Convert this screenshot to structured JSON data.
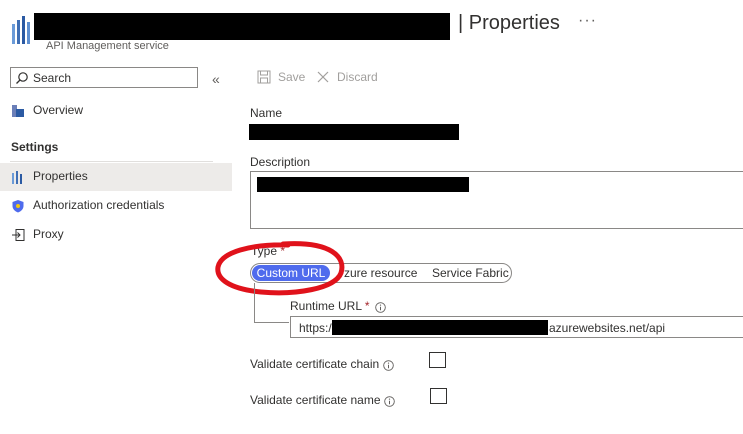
{
  "header": {
    "title": "| Properties",
    "subtitle": "API Management service",
    "more_label": "···"
  },
  "sidebar": {
    "search_placeholder": "Search",
    "collapse_label": "«",
    "items": [
      {
        "label": "Overview"
      },
      {
        "label": "Properties"
      },
      {
        "label": "Authorization credentials"
      },
      {
        "label": "Proxy"
      }
    ],
    "settings_header": "Settings"
  },
  "toolbar": {
    "save_label": "Save",
    "discard_label": "Discard"
  },
  "form": {
    "name_label": "Name",
    "description_label": "Description",
    "type_label": "Type",
    "type_required": "*",
    "type_options": [
      "Custom URL",
      "Azure resource",
      "Service Fabric"
    ],
    "type_selected": "Custom URL",
    "type_option_partial": "zure resource",
    "runtime_url_label": "Runtime URL",
    "runtime_url_required": "*",
    "runtime_url_prefix": "https:/",
    "runtime_url_suffix": "azurewebsites.net/api",
    "validate_chain_label": "Validate certificate chain",
    "validate_name_label": "Validate certificate name",
    "validate_chain_checked": false,
    "validate_name_checked": false
  },
  "colors": {
    "accent": "#4f6bed",
    "annotation": "#e0121b",
    "selected_bg": "#edebe9",
    "required": "#a4262c"
  }
}
